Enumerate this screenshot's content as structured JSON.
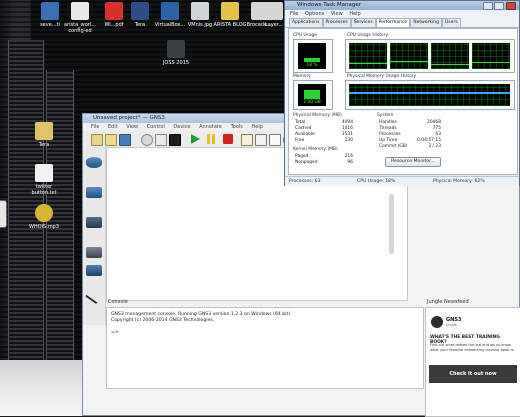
{
  "desktop": {
    "top_icons": [
      {
        "label": "seve...ti"
      },
      {
        "label": "arista_worl...\nconfig-ed"
      },
      {
        "label": "Wi...pdf"
      },
      {
        "label": "Tera"
      },
      {
        "label": "VirtualBox..."
      },
      {
        "label": "VMnis.jpg"
      },
      {
        "label": "ARISTA BLOG"
      },
      {
        "label": "Brocade ..."
      },
      {
        "label": "Layer..."
      }
    ],
    "center_icon": {
      "label": "JOSS 2015"
    },
    "left_icons": [
      {
        "label": "Tera"
      },
      {
        "label": "twitter\nbutton.txt"
      },
      {
        "label": "WHOIS.mp3"
      }
    ]
  },
  "gns3": {
    "title": "Unsaved project* — GNS3",
    "menu": [
      "File",
      "Edit",
      "View",
      "Control",
      "Device",
      "Annotate",
      "Tools",
      "Help"
    ],
    "console_title": "Console",
    "console_lines": [
      "GNS3 management console. Running GNS3 version 1.2.3 on Windows (64 bit).",
      "Copyright (c) 2006-2014 GNS3 Technologies.",
      "",
      "=>"
    ],
    "news_title": "Jungle Newsfeed",
    "news_brand": "GNS3",
    "news_brand_sub": "Jungle",
    "news_heading": "WHAT'S THE BEST TRAINING BOOK?",
    "news_body": "Find out what makes the cut and let us know what your favorite networking training book is.",
    "news_cta": "Check it out now"
  },
  "task_manager": {
    "title": "Windows Task Manager",
    "menu": [
      "File",
      "Options",
      "View",
      "Help"
    ],
    "tabs": [
      "Applications",
      "Processes",
      "Services",
      "Performance",
      "Networking",
      "Users"
    ],
    "active_tab": "Performance",
    "cpu_usage_label": "CPU Usage",
    "cpu_usage_value": "18 %",
    "cpu_history_label": "CPU Usage History",
    "memory_label": "Memory",
    "memory_value": "2.50 GB",
    "mem_history_label": "Physical Memory Usage History",
    "physical_memory": {
      "title": "Physical Memory (MB)",
      "rows": [
        {
          "k": "Total",
          "v": "4094"
        },
        {
          "k": "Cached",
          "v": "1416"
        },
        {
          "k": "Available",
          "v": "1531"
        },
        {
          "k": "Free",
          "v": "130"
        }
      ]
    },
    "kernel_memory": {
      "title": "Kernel Memory (MB)",
      "rows": [
        {
          "k": "Paged",
          "v": "216"
        },
        {
          "k": "Nonpaged",
          "v": "96"
        }
      ]
    },
    "system": {
      "title": "System",
      "rows": [
        {
          "k": "Handles",
          "v": "20468"
        },
        {
          "k": "Threads",
          "v": "775"
        },
        {
          "k": "Processes",
          "v": "63"
        },
        {
          "k": "Up Time",
          "v": "0:04:57:15"
        },
        {
          "k": "Commit (GB)",
          "v": "2 / 23"
        }
      ]
    },
    "resource_monitor_button": "Resource Monitor...",
    "status": {
      "processes": "Processes: 63",
      "cpu": "CPU Usage: 18%",
      "memory": "Physical Memory: 62%"
    }
  },
  "colors": {
    "graph_green": "#2ad12a",
    "graph_blue": "#3aa7ff",
    "title_blue": "#a9c3e2"
  }
}
